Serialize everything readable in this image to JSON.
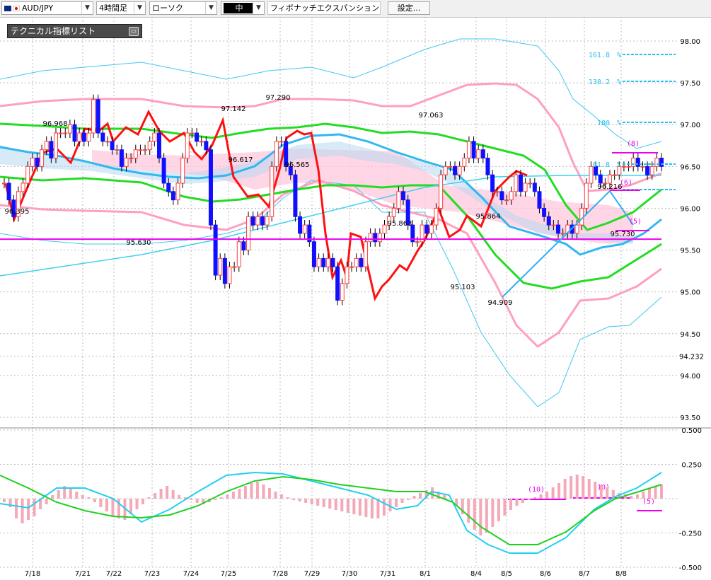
{
  "toolbar": {
    "symbol": "AUD/JPY",
    "timeframe": "4時間足",
    "chart_type": "ローソク",
    "style_value": "中",
    "tool_name": "フィボナッチエクスパンション",
    "settings_label": "設定..."
  },
  "indicator_panel": {
    "title": "テクニカル指標リスト"
  },
  "chart_data": {
    "type": "candlestick",
    "instrument": "AUD/JPY",
    "timeframe": "4時間足",
    "x_labels": [
      "7/18",
      "7/21",
      "7/22",
      "7/23",
      "7/24",
      "7/25",
      "7/28",
      "7/29",
      "7/30",
      "7/31",
      "8/1",
      "8/4",
      "8/5",
      "8/6",
      "8/7",
      "8/8"
    ],
    "price_axis": {
      "ticks": [
        98.0,
        97.5,
        97.0,
        96.5,
        96.0,
        95.5,
        95.0,
        94.5,
        94.0,
        93.5
      ],
      "ylim": [
        93.3,
        98.1
      ],
      "current_price": 94.232,
      "current_price_label": "94.232"
    },
    "oscillator_axis": {
      "ticks": [
        0.5,
        0.25,
        -0.25,
        -0.5
      ],
      "tick_labels": [
        "0.500",
        "0.250",
        "-0.250",
        "-0.500"
      ],
      "ylim": [
        -0.5,
        0.5
      ]
    },
    "price_annotations": [
      "96.968",
      "96.395",
      "95.630",
      "97.142",
      "96.617",
      "97.290",
      "96.565",
      "95.863",
      "97.063",
      "95.103",
      "95.864",
      "94.909",
      "96.216",
      "95.730"
    ],
    "fibonacci_levels": [
      {
        "label": "161.8",
        "price": 97.85,
        "marker": "%"
      },
      {
        "label": "138.2",
        "price": 97.48,
        "marker": "%"
      },
      {
        "label": "100",
        "price": 96.94,
        "marker": "%"
      },
      {
        "label": "61.8",
        "price": 96.55,
        "marker": "%"
      }
    ],
    "cycle_labels": [
      "(8)",
      "(6)",
      "(5)",
      "(10)",
      "(10)",
      "(5)"
    ],
    "horizontal_line": 95.63,
    "colors": {
      "up_candle": "#ff4040",
      "down_candle": "#1010ff",
      "red_line": "#ff1010",
      "green_line": "#22dd22",
      "blue_line": "#30b8f0",
      "pink_band": "#ff9fc0",
      "fib": "#20c0f0",
      "magenta": "#ee00ee",
      "cloud": "#ffc8dc"
    },
    "series": [
      {
        "values": [
          96.3,
          96.1,
          95.9,
          96.2,
          96.3,
          96.5,
          96.6,
          96.5,
          96.7,
          96.8,
          96.6,
          96.9,
          96.9,
          96.9,
          97.0,
          96.8,
          96.9,
          96.8,
          96.9,
          97.3,
          96.9,
          96.8,
          96.8,
          96.7,
          96.7,
          96.5,
          96.6,
          96.6,
          96.7,
          96.7,
          96.7,
          96.8,
          96.9,
          96.6,
          96.3,
          96.2,
          96.1,
          96.3,
          96.6,
          96.9,
          96.9,
          96.8,
          96.8,
          96.7,
          95.8,
          95.2,
          95.4,
          95.1,
          95.3,
          95.3,
          95.6,
          95.5,
          95.9,
          95.8,
          95.9,
          95.8,
          95.9,
          96.5,
          96.8,
          96.8,
          96.5,
          96.4,
          95.9,
          95.7,
          95.8,
          95.6,
          95.3,
          95.4,
          95.3,
          95.4,
          95.3,
          94.9,
          95.1,
          95.3,
          95.3,
          95.4,
          95.3,
          95.6,
          95.7,
          95.6,
          95.7,
          95.8,
          95.9,
          96.0,
          96.2,
          96.1,
          95.8,
          95.6,
          95.6,
          95.8,
          95.7,
          95.8,
          96.0,
          96.4,
          96.5,
          96.5,
          96.4,
          96.5,
          96.6,
          96.8,
          96.6,
          96.7,
          96.6,
          96.4,
          96.2,
          96.2,
          96.1,
          96.1,
          96.2,
          96.4,
          96.2,
          96.3,
          96.3,
          96.2,
          96.0,
          95.9,
          95.8,
          95.8,
          95.7,
          95.7,
          95.8,
          95.7,
          95.8,
          96.0,
          96.3,
          96.5,
          96.4,
          96.3,
          96.3,
          96.4,
          96.4,
          96.5,
          96.5,
          96.5,
          96.6,
          96.5,
          96.5,
          96.4,
          96.5,
          96.6,
          96.5
        ]
      }
    ]
  }
}
